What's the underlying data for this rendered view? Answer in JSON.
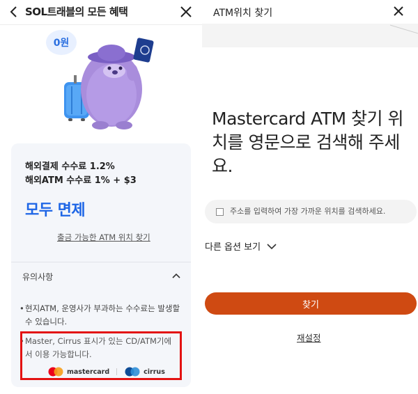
{
  "left": {
    "header": {
      "title": "SOL트래블의 모든 혜택"
    },
    "hero": {
      "badge": "0원"
    },
    "card": {
      "fee_line1": "해외결제 수수료 1.2%",
      "fee_line2": "해외ATM 수수료 1% + $3",
      "headline": "모두 면제",
      "atm_link": "출금 가능한 ATM 위치 찾기"
    },
    "notice": {
      "title": "유의사항",
      "bullet1": "현지ATM, 운영사가 부과하는 수수료는 발생할 수 있습니다.",
      "bullet2": "Master, Cirrus 표시가 있는 CD/ATM기에서 이용 가능합니다.",
      "logos": [
        {
          "name": "mastercard"
        },
        {
          "name": "cirrus"
        }
      ]
    }
  },
  "right": {
    "header": {
      "title": "ATM위치 찾기"
    },
    "heading": "Mastercard ATM 찾기 위치를 영문으로 검색해 주세요.",
    "search": {
      "placeholder": "주소를 입력하여 가장 가까운 위치를 검색하세요."
    },
    "options_label": "다른 옵션 보기",
    "find_button": "찾기",
    "reset_link": "재설정"
  },
  "colors": {
    "accent_blue": "#1e66e6",
    "button_orange": "#cf4a12",
    "highlight_red": "#e31212"
  }
}
